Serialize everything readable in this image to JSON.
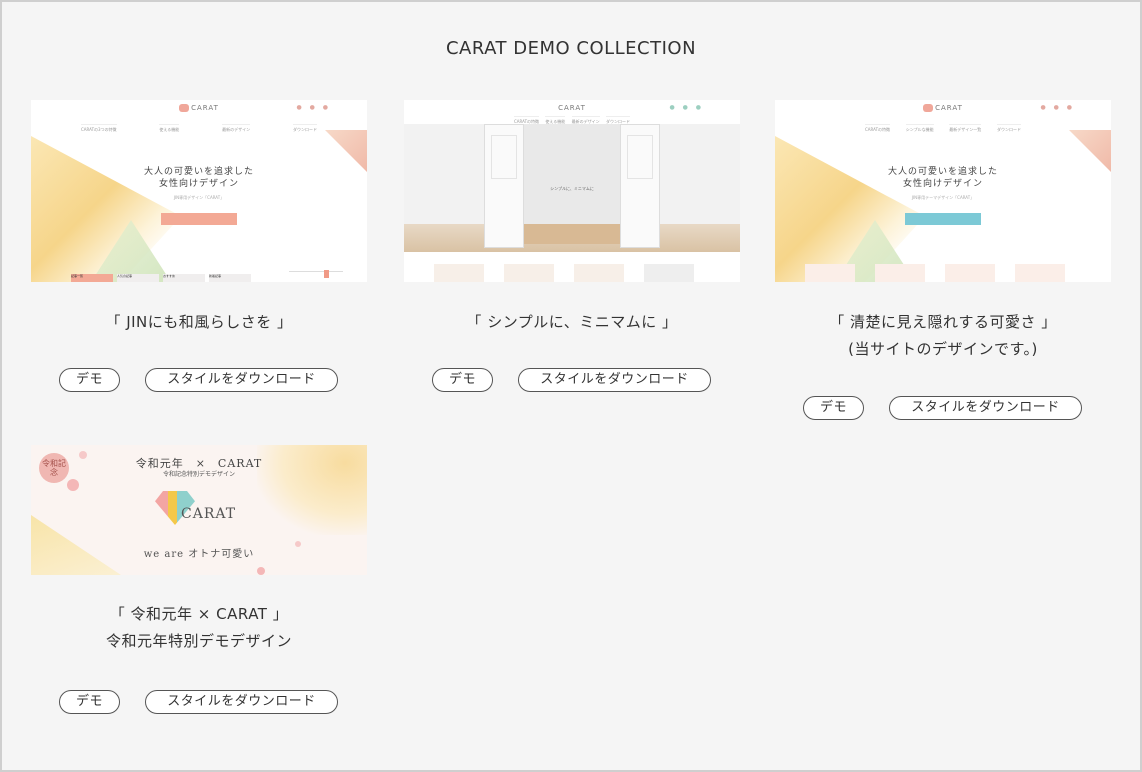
{
  "page": {
    "title": "CARAT DEMO COLLECTION"
  },
  "buttons": {
    "demo_label": "デモ",
    "download_label": "スタイルをダウンロード"
  },
  "cards": [
    {
      "caption_line1": "「 JINにも和風らしさを 」",
      "caption_line2": "",
      "thumb": {
        "logo": "CARAT",
        "social": "● ● ●",
        "nav": [
          "CARATの3つの特徴",
          "使える機能",
          "最新のデザイン",
          "ダウンロード"
        ],
        "headline_1": "大人の可愛いを追求した",
        "headline_2": "女性向けデザイン",
        "sub": "JIN専用デザイン「CARAT」",
        "tabs": [
          "記事一覧",
          "人気の記事",
          "おすすめ",
          "新着記事"
        ]
      }
    },
    {
      "caption_line1": "「 シンプルに、ミニマムに 」",
      "caption_line2": "",
      "thumb": {
        "logo": "CARAT",
        "social": "● ● ●",
        "nav": [
          "CARATの特徴",
          "使える機能",
          "最新のデザイン",
          "ダウンロード"
        ],
        "door_text": "シンプルに、ミニマムに"
      }
    },
    {
      "caption_line1": "「 清楚に見え隠れする可愛さ 」",
      "caption_line2": "(当サイトのデザインです。)",
      "thumb": {
        "logo": "CARAT",
        "social": "● ● ●",
        "nav": [
          "CARATの特徴",
          "シンプルな機能",
          "最新デザイン一覧",
          "ダウンロード"
        ],
        "headline_1": "大人の可愛いを追求した",
        "headline_2": "女性向けデザイン",
        "sub": "JIN専用テーマデザイン「CARAT」"
      }
    },
    {
      "caption_line1": "「 令和元年 × CARAT 」",
      "caption_line2": "令和元年特別デモデザイン",
      "thumb": {
        "stamp": "令和記念",
        "title": "令和元年　×　CARAT",
        "sub": "令和記念特別デモデザイン",
        "brand": "CARAT",
        "tagline": "we are オトナ可愛い"
      }
    }
  ]
}
